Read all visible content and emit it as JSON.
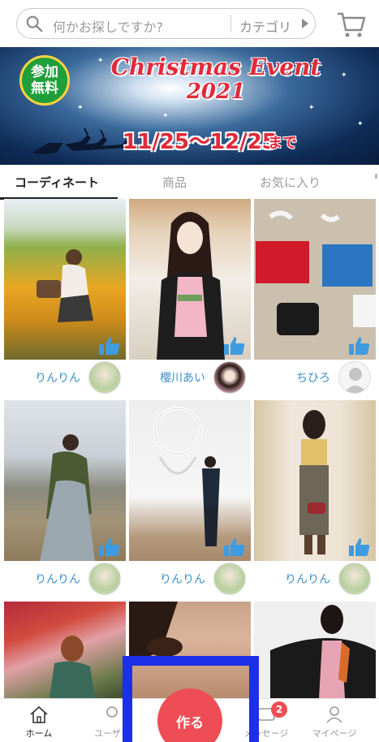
{
  "search": {
    "placeholder": "何かお探しですか?",
    "category_label": "カテゴリ",
    "icon": "search-icon"
  },
  "header": {
    "cart_icon": "cart-icon"
  },
  "banner": {
    "badge_line1": "参加",
    "badge_line2": "無料",
    "title": "Christmas Event",
    "year": "2021",
    "dates": "11/25〜12/25",
    "suffix": "まで"
  },
  "tabs": [
    {
      "label": "コーディネート",
      "active": true
    },
    {
      "label": "商品",
      "active": false
    },
    {
      "label": "お気に入り",
      "active": false
    }
  ],
  "posts": [
    {
      "user": "りんりん",
      "scene": "flower-field",
      "avatar": "photo"
    },
    {
      "user": "櫻川あい",
      "scene": "kimono-pose",
      "avatar": "photo"
    },
    {
      "user": "ちひろ",
      "scene": "costume-flatlay",
      "avatar": "default-user"
    },
    {
      "user": "りんりん",
      "scene": "mountain-smoke",
      "avatar": "photo"
    },
    {
      "user": "りんりん",
      "scene": "neon-wall",
      "avatar": "photo"
    },
    {
      "user": "りんりん",
      "scene": "plaid-dress",
      "avatar": "photo"
    },
    {
      "user": "",
      "scene": "autumn-leaves",
      "avatar": ""
    },
    {
      "user": "",
      "scene": "closeup-man",
      "avatar": ""
    },
    {
      "user": "",
      "scene": "black-haori",
      "avatar": ""
    }
  ],
  "bottom_nav": {
    "home": "ホーム",
    "users": "ユーザー",
    "make": "作る",
    "messages": "メッセージ",
    "mypage": "マイページ",
    "badge_count": "2"
  },
  "colors": {
    "accent": "#ef4d55",
    "link": "#3b8fc8",
    "like": "#3f9be0",
    "overlay_frame": "#1c30e8"
  }
}
